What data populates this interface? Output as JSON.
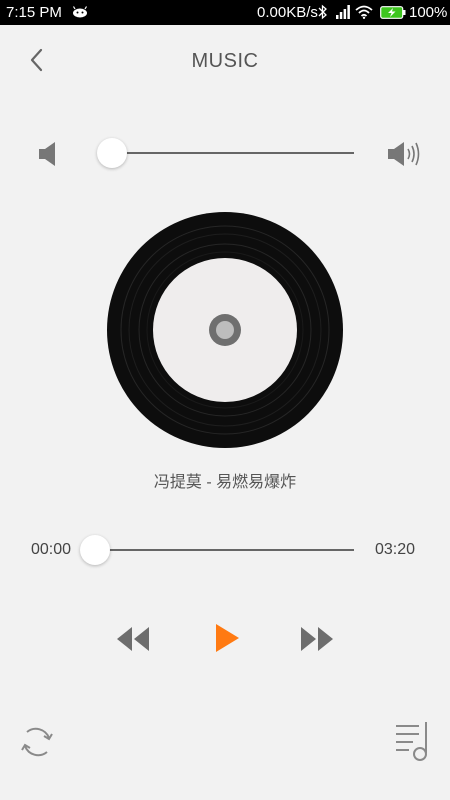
{
  "status_bar": {
    "time": "7:15",
    "period": "PM",
    "network_speed": "0.00KB/s",
    "battery_percent": "100%",
    "icons": [
      "notification-icon",
      "bluetooth-icon",
      "signal-icon",
      "wifi-icon",
      "battery-charging-icon"
    ]
  },
  "header": {
    "title": "MUSIC",
    "back_icon": "chevron-left-icon"
  },
  "volume": {
    "low_icon": "volume-low-icon",
    "high_icon": "volume-high-icon",
    "level": 0.0
  },
  "player": {
    "song": "冯提莫 - 易燃易爆炸",
    "current_time": "00:00",
    "total_time": "03:20",
    "progress": 0.0,
    "state": "paused"
  },
  "controls": {
    "rewind_icon": "rewind-icon",
    "play_icon": "play-icon",
    "forward_icon": "fast-forward-icon",
    "repeat_icon": "repeat-icon",
    "playlist_icon": "playlist-icon"
  },
  "colors": {
    "accent": "#ff7a12",
    "background": "#f2f2f2",
    "icon_gray": "#6d6d6d"
  }
}
